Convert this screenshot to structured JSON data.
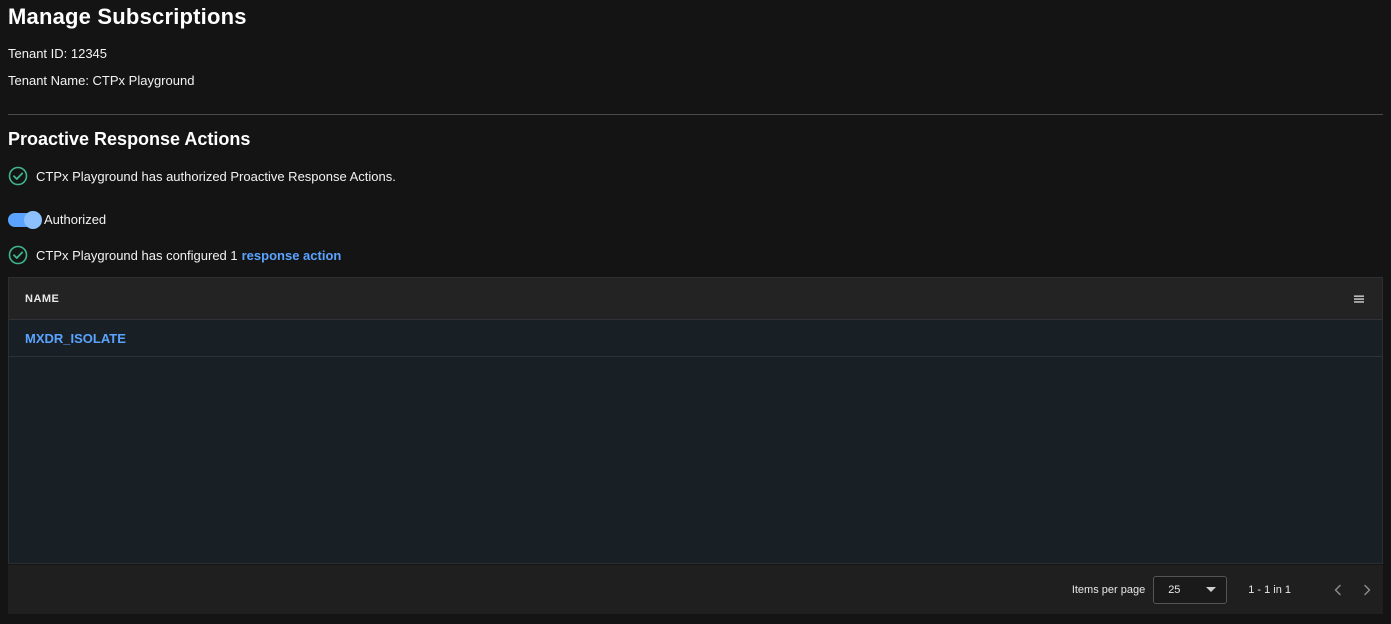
{
  "header": {
    "title": "Manage Subscriptions",
    "tenant_id": "Tenant ID: 12345",
    "tenant_name": "Tenant Name: CTPx Playground"
  },
  "proactive": {
    "title": "Proactive Response Actions",
    "authorized_message": "CTPx Playground has authorized Proactive Response Actions.",
    "toggle_label": "Authorized",
    "toggle_on": true,
    "configured_message": "CTPx Playground has configured 1",
    "configured_link": "response action"
  },
  "table": {
    "columns": [
      "NAME"
    ],
    "rows": [
      {
        "name": "MXDR_ISOLATE"
      }
    ]
  },
  "pagination": {
    "items_per_page_label": "Items per page",
    "items_per_page_value": "25",
    "range_text": "1 - 1 in 1"
  },
  "colors": {
    "accent": "#5aa3ff",
    "success": "#3fb68b",
    "background": "#141414"
  },
  "icons": {
    "status": "check-circle-icon",
    "column_menu": "menu-icon",
    "prev": "chevron-left-icon",
    "next": "chevron-right-icon"
  }
}
